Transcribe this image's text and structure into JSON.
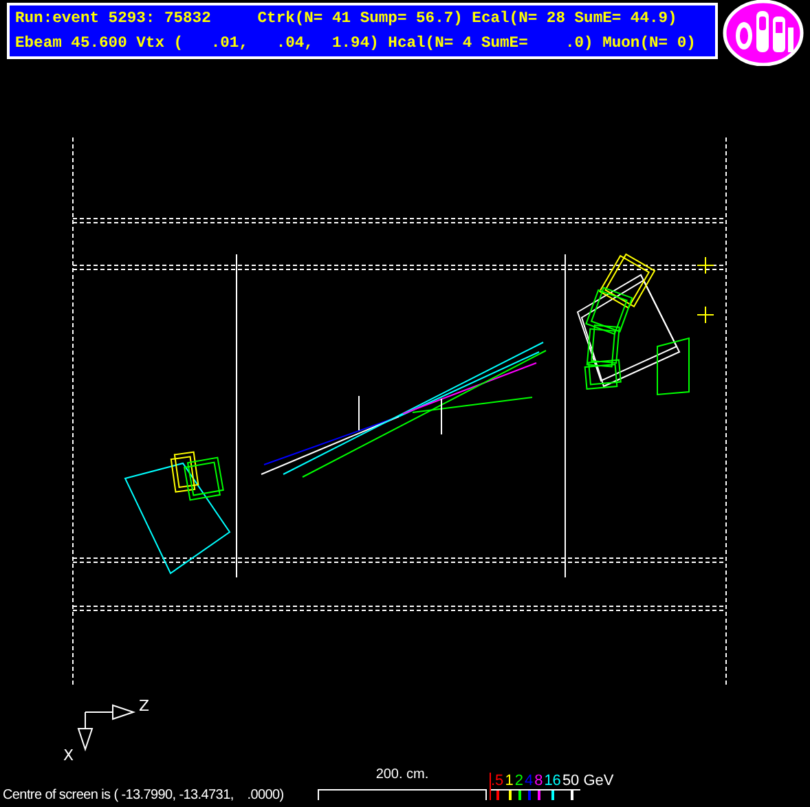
{
  "header": {
    "lines": [
      "Run:event 5293: 75832     Ctrk(N= 41 Sump= 56.7) Ecal(N= 28 SumE= 44.9)",
      "Ebeam 45.600 Vtx (   .01,   .04,  1.94) Hcal(N= 4 SumE=    .0) Muon(N= 0)"
    ]
  },
  "axes": {
    "horizontal": "Z",
    "vertical": "X"
  },
  "status_bar": "Centre of screen is ( -13.7990, -13.4731,    .0000)",
  "scale_bar": {
    "label": "200. cm."
  },
  "energy_scale": {
    "items": [
      {
        "label": ".5",
        "color": "#ff0000"
      },
      {
        "label": "1",
        "color": "#ffff00"
      },
      {
        "label": "2",
        "color": "#00ff00"
      },
      {
        "label": "4",
        "color": "#0000ff"
      },
      {
        "label": "8",
        "color": "#ff00ff"
      },
      {
        "label": "16",
        "color": "#00ffff"
      },
      {
        "label": "50",
        "color": "#ffffff"
      }
    ],
    "unit": "GeV"
  }
}
